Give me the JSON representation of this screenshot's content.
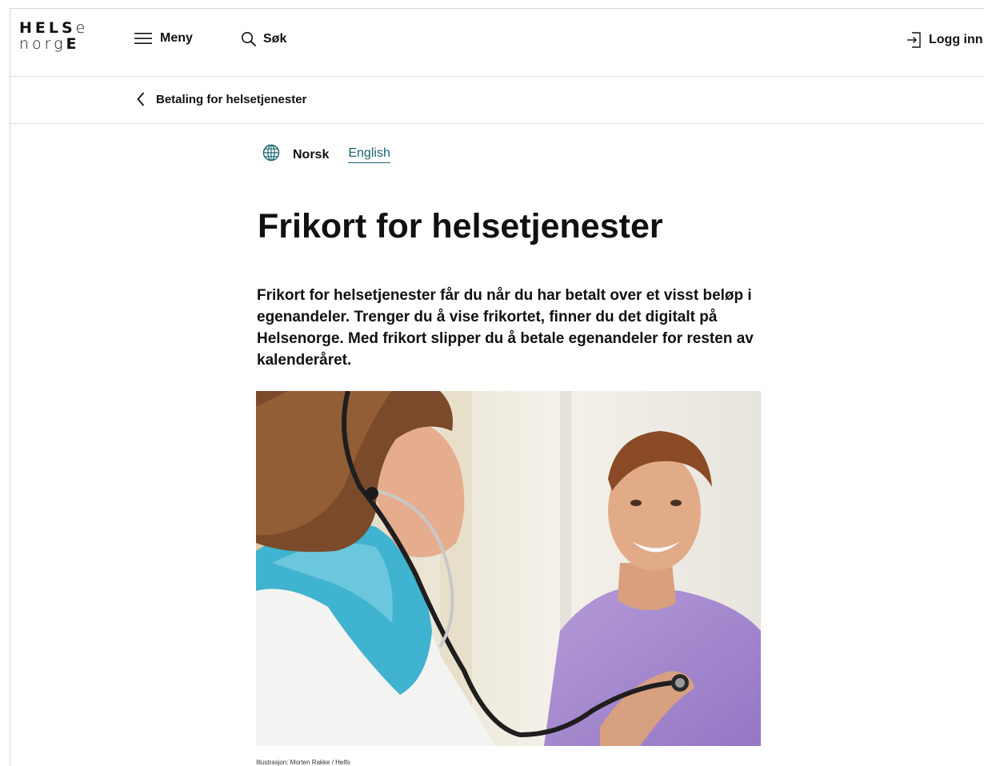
{
  "header": {
    "logo_top": "HELSe",
    "logo_bottom": "norgE",
    "menu_label": "Meny",
    "search_label": "Søk",
    "login_label": "Logg inn"
  },
  "breadcrumb": {
    "label": "Betaling for helsetjenester"
  },
  "language": {
    "current": "Norsk",
    "alternate": "English"
  },
  "article": {
    "title": "Frikort for helsetjenester",
    "ingress": "Frikort for helsetjenester får du når du har betalt over et visst beløp i egenandeler. Trenger du å vise frikortet, finner du det digitalt på Helsenorge. Med frikort slipper du å betale egenandeler for resten av kalenderåret.",
    "image_caption": "Illustrasjon: Morten Rakke / Helfo"
  },
  "colors": {
    "link": "#17646e",
    "text": "#111111",
    "divider": "#e0e0e0"
  }
}
